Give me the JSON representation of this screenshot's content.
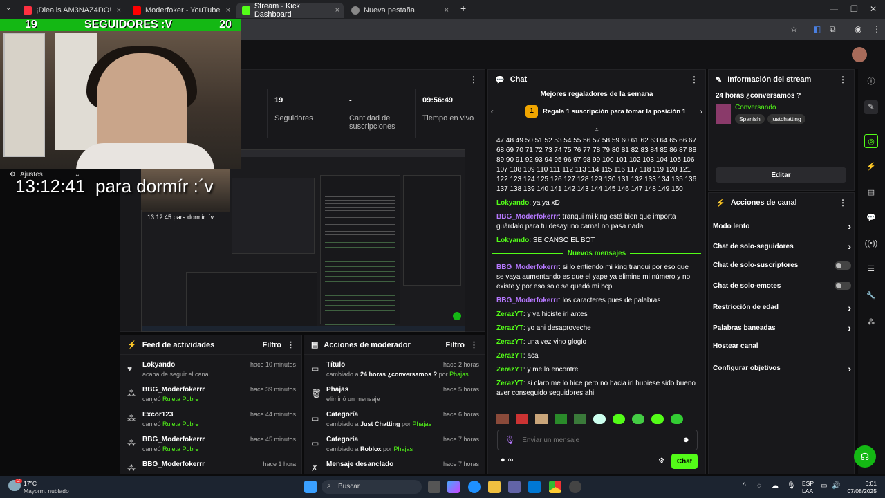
{
  "browser": {
    "tabs": [
      {
        "label": "¡Diealis AM3NAZ4DO!",
        "color": "#ff3040"
      },
      {
        "label": "Moderfoker - YouTube",
        "color": "#ff0000"
      },
      {
        "label": "Stream - Kick Dashboard",
        "color": "#53fc18"
      },
      {
        "label": "Nueva pestaña",
        "color": "#888888"
      }
    ],
    "close": "×",
    "add": "+"
  },
  "overlay": {
    "followers_left": "19",
    "followers_text": "SEGUIDORES :V",
    "followers_right": "20",
    "ajustes": "Ajustes",
    "clock": "13:12:41",
    "caption": "para dormír :´v",
    "nested_clock": "13:12:45",
    "nested_caption": "para dormir :´v"
  },
  "stats": [
    {
      "value": "19",
      "label": "Seguidores"
    },
    {
      "value": "-",
      "label": "Cantidad de suscripciones"
    },
    {
      "value": "09:56:49",
      "label": "Tiempo en vivo"
    }
  ],
  "feed": {
    "title": "Feed de actividades",
    "filter": "Filtro",
    "items": [
      {
        "name": "Lokyando",
        "desc": "acaba de seguir el canal",
        "highlight": "",
        "time": "hace 10 minutos",
        "icon": "heart-icon"
      },
      {
        "name": "BBG_Moderfokerrr",
        "desc": "canjeó ",
        "highlight": "Ruleta Pobre",
        "time": "hace 39 minutos",
        "icon": "gift-icon"
      },
      {
        "name": "Excor123",
        "desc": "canjeó ",
        "highlight": "Ruleta Pobre",
        "time": "hace 44 minutos",
        "icon": "gift-icon"
      },
      {
        "name": "BBG_Moderfokerrr",
        "desc": "canjeó ",
        "highlight": "Ruleta Pobre",
        "time": "hace 45 minutos",
        "icon": "gift-icon"
      },
      {
        "name": "BBG_Moderfokerrr",
        "desc": "",
        "highlight": "",
        "time": "hace 1 hora",
        "icon": "gift-icon"
      }
    ]
  },
  "mod": {
    "title": "Acciones de moderador",
    "filter": "Filtro",
    "items": [
      {
        "name": "Título",
        "desc": "cambiado a ",
        "highlight": "24 horas ¿conversamos ?",
        "by": " por ",
        "user": "Phajas",
        "time": "hace 2 horas",
        "icon": "title-icon"
      },
      {
        "name": "Phajas",
        "desc": "eliminó un mensaje",
        "highlight": "",
        "by": "",
        "user": "",
        "time": "hace 5 horas",
        "icon": "trash-icon"
      },
      {
        "name": "Categoría",
        "desc": "cambiado a ",
        "highlight": "Just Chatting",
        "by": " por ",
        "user": "Phajas",
        "time": "hace 6 horas",
        "icon": "category-icon"
      },
      {
        "name": "Categoría",
        "desc": "cambiado a ",
        "highlight": "Roblox",
        "by": " por ",
        "user": "Phajas",
        "time": "hace 7 horas",
        "icon": "category-icon"
      },
      {
        "name": "Mensaje desanclado",
        "desc": "",
        "highlight": "",
        "by": "",
        "user": "",
        "time": "hace 7 horas",
        "icon": "unpin-icon"
      }
    ]
  },
  "chat": {
    "title": "Chat",
    "top_title": "Mejores regaladores de la semana",
    "top_rank": "1",
    "top_text": "Regala 1 suscripción para tomar la posición 1",
    "numbers": "47 48 49 50 51 52 53 54 55 56 57 58 59 60 61 62 63 64 65 66 67 68 69 70 71 72 73 74 75 76 77 78 79 80 81 82 83 84 85 86 87 88 89 90 91 92 93 94 95 96 97 98 99 100 101 102 103 104 105 106 107 108 109 110 111 112 113 114 115 116 117 118 119 120 121 122 123 124 125 126 127 128 129 130 131 132 133 134 135 136 137 138 139 140 141 142 143 144 145 146 147 148 149 150",
    "new_messages": "Nuevos mensajes",
    "messages_before": [
      {
        "user": "Lokyando",
        "color": "green",
        "text": ": ya ya xD"
      },
      {
        "user": "BBG_Moderfokerrr",
        "color": "purple",
        "text": ": tranqui mi king está bien que importa guárdalo para tu desayuno carnal no pasa nada"
      },
      {
        "user": "Lokyando",
        "color": "green",
        "text": ": SE CANSO EL BOT"
      }
    ],
    "messages_after": [
      {
        "user": "BBG_Moderfokerrr",
        "color": "purple",
        "text": ": si lo entiendo mi king tranqui por eso que se vaya aumentando es que el yape ya elimine mi número y no existe y por eso solo se quedó mi bcp"
      },
      {
        "user": "BBG_Moderfokerrr",
        "color": "purple",
        "text": ": los caracteres pues de palabras"
      },
      {
        "user": "ZerazYT",
        "color": "green",
        "text": ": y ya hiciste irl antes"
      },
      {
        "user": "ZerazYT",
        "color": "green",
        "text": ": yo ahi desaproveche"
      },
      {
        "user": "ZerazYT",
        "color": "green",
        "text": ": una vez vino gloglo"
      },
      {
        "user": "ZerazYT",
        "color": "green",
        "text": ": aca"
      },
      {
        "user": "ZerazYT",
        "color": "green",
        "text": ": y me lo encontre"
      },
      {
        "user": "ZerazYT",
        "color": "green",
        "text": ": si claro me lo hice pero no hacia irl hubiese sido bueno aver conseguido seguidores ahi"
      }
    ],
    "placeholder": "Enviar un mensaje",
    "send": "Chat",
    "infinity": "∞"
  },
  "info": {
    "title": "Información del stream",
    "stream_title": "24 horas ¿conversamos ?",
    "category": "Conversando",
    "tags": [
      "Spanish",
      "justchatting"
    ],
    "edit": "Editar"
  },
  "actions": {
    "title": "Acciones de canal",
    "rows": [
      {
        "label": "Modo lento",
        "kind": "chevron"
      },
      {
        "label": "Chat de solo-seguidores",
        "kind": "chevron"
      },
      {
        "label": "Chat de solo-suscriptores",
        "kind": "toggle"
      },
      {
        "label": "Chat de solo-emotes",
        "kind": "toggle"
      },
      {
        "label": "Restricción de edad",
        "kind": "chevron"
      },
      {
        "label": "Palabras baneadas",
        "kind": "chevron"
      },
      {
        "label": "Hostear canal",
        "kind": "none"
      },
      {
        "label": "Configurar objetivos",
        "kind": "chevron"
      }
    ]
  },
  "taskbar": {
    "weather_temp": "17°C",
    "weather_desc": "Mayorm. nublado",
    "search": "Buscar",
    "lang": "ESP",
    "lang2": "LAA",
    "time": "6:01",
    "date": "07/08/2025",
    "badge": "2"
  }
}
